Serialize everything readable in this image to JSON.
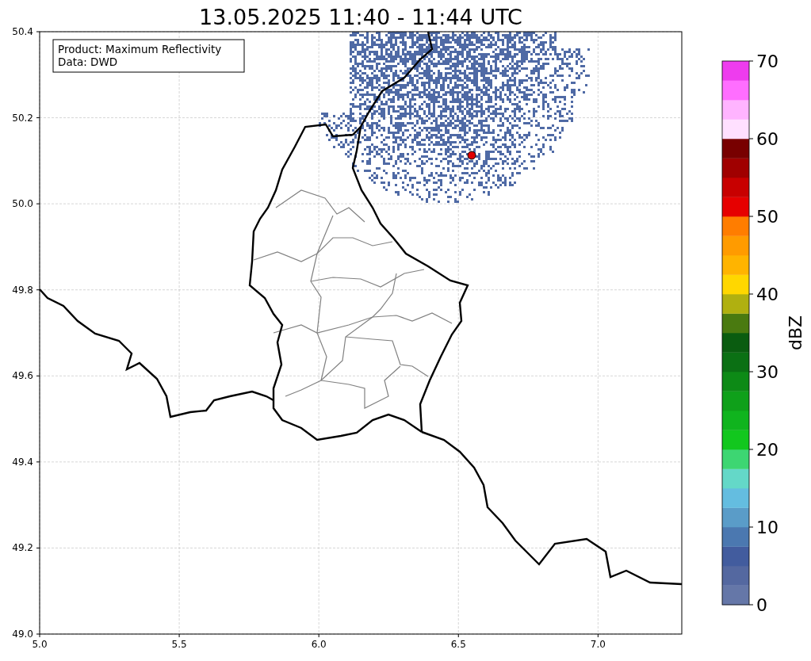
{
  "title": "13.05.2025 11:40 - 11:44 UTC",
  "legend": {
    "lines": [
      "Product: Maximum Reflectivity",
      "Data: DWD"
    ]
  },
  "x_axis": {
    "ticks": [
      "5.0",
      "5.5",
      "6.0",
      "6.5",
      "7.0"
    ]
  },
  "y_axis": {
    "ticks": [
      "50.4",
      "50.2",
      "50.0",
      "49.8",
      "49.6",
      "49.4",
      "49.2",
      "49.0"
    ]
  },
  "colorbar": {
    "label": "dBZ",
    "ticks": [
      "70",
      "60",
      "50",
      "40",
      "30",
      "20",
      "10",
      "0"
    ],
    "segments": [
      {
        "color": "#6577a8"
      },
      {
        "color": "#5468a0"
      },
      {
        "color": "#425c9e"
      },
      {
        "color": "#4b78b0"
      },
      {
        "color": "#5a9cc8"
      },
      {
        "color": "#64bde0"
      },
      {
        "color": "#64d8c8"
      },
      {
        "color": "#3dd672"
      },
      {
        "color": "#12c71e"
      },
      {
        "color": "#10b41e"
      },
      {
        "color": "#0fa01a"
      },
      {
        "color": "#0d8a16"
      },
      {
        "color": "#0b7014"
      },
      {
        "color": "#0a5c10"
      },
      {
        "color": "#4a7a10"
      },
      {
        "color": "#b0b010"
      },
      {
        "color": "#ffd700"
      },
      {
        "color": "#ffb400"
      },
      {
        "color": "#ff9b00"
      },
      {
        "color": "#ff7d00"
      },
      {
        "color": "#e60000"
      },
      {
        "color": "#c80000"
      },
      {
        "color": "#a00000"
      },
      {
        "color": "#780000"
      },
      {
        "color": "#ffe0ff"
      },
      {
        "color": "#ffb4ff"
      },
      {
        "color": "#ff6eff"
      },
      {
        "color": "#ee3cee"
      }
    ]
  }
}
